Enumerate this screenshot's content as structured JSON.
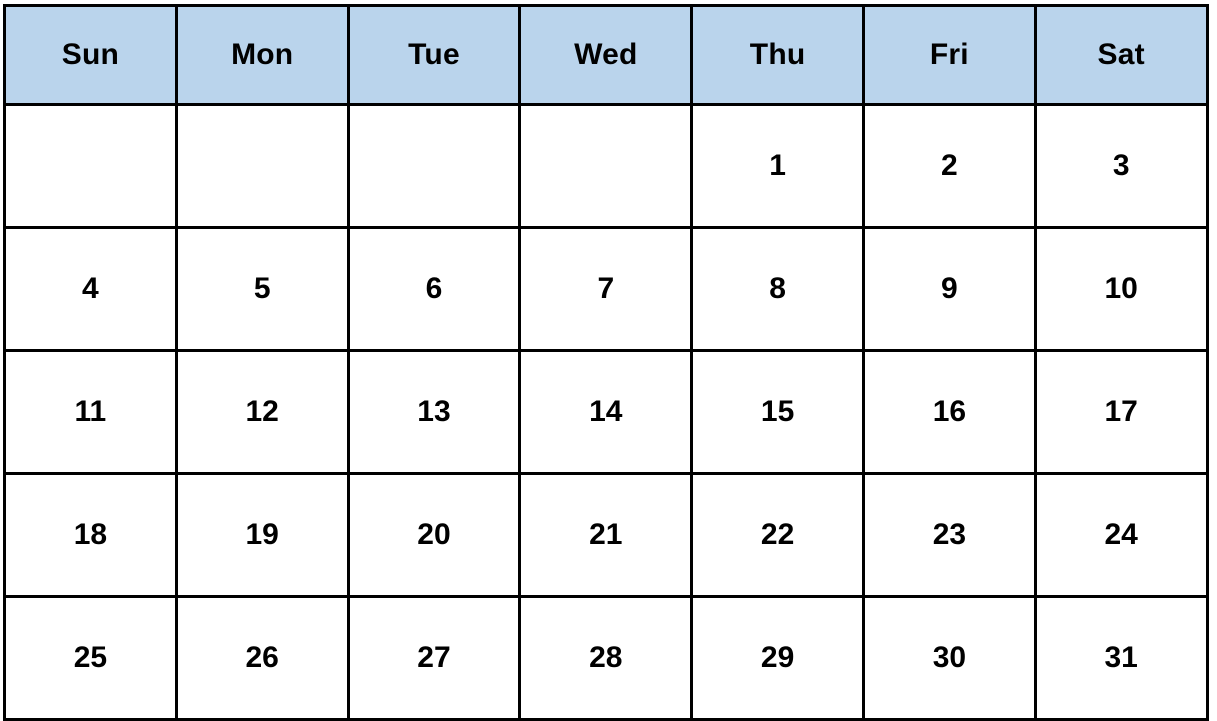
{
  "calendar": {
    "colors": {
      "header_background": "#bad4ec",
      "grid_border": "#000000",
      "cell_background": "#ffffff",
      "text": "#000000"
    },
    "weekday_headers": [
      {
        "label": "Sun"
      },
      {
        "label": "Mon"
      },
      {
        "label": "Tue"
      },
      {
        "label": "Wed"
      },
      {
        "label": "Thu"
      },
      {
        "label": "Fri"
      },
      {
        "label": "Sat"
      }
    ],
    "weeks": [
      {
        "days": [
          {
            "label": "",
            "empty": true
          },
          {
            "label": "",
            "empty": true
          },
          {
            "label": "",
            "empty": true
          },
          {
            "label": "",
            "empty": true
          },
          {
            "label": "1",
            "empty": false
          },
          {
            "label": "2",
            "empty": false
          },
          {
            "label": "3",
            "empty": false
          }
        ]
      },
      {
        "days": [
          {
            "label": "4",
            "empty": false
          },
          {
            "label": "5",
            "empty": false
          },
          {
            "label": "6",
            "empty": false
          },
          {
            "label": "7",
            "empty": false
          },
          {
            "label": "8",
            "empty": false
          },
          {
            "label": "9",
            "empty": false
          },
          {
            "label": "10",
            "empty": false
          }
        ]
      },
      {
        "days": [
          {
            "label": "11",
            "empty": false
          },
          {
            "label": "12",
            "empty": false
          },
          {
            "label": "13",
            "empty": false
          },
          {
            "label": "14",
            "empty": false
          },
          {
            "label": "15",
            "empty": false
          },
          {
            "label": "16",
            "empty": false
          },
          {
            "label": "17",
            "empty": false
          }
        ]
      },
      {
        "days": [
          {
            "label": "18",
            "empty": false
          },
          {
            "label": "19",
            "empty": false
          },
          {
            "label": "20",
            "empty": false
          },
          {
            "label": "21",
            "empty": false
          },
          {
            "label": "22",
            "empty": false
          },
          {
            "label": "23",
            "empty": false
          },
          {
            "label": "24",
            "empty": false
          }
        ]
      },
      {
        "days": [
          {
            "label": "25",
            "empty": false
          },
          {
            "label": "26",
            "empty": false
          },
          {
            "label": "27",
            "empty": false
          },
          {
            "label": "28",
            "empty": false
          },
          {
            "label": "29",
            "empty": false
          },
          {
            "label": "30",
            "empty": false
          },
          {
            "label": "31",
            "empty": false
          }
        ]
      }
    ]
  }
}
